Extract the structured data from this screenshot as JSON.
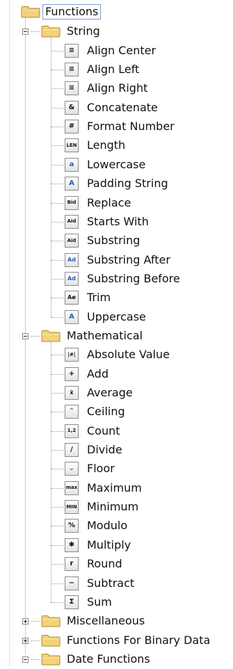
{
  "tree": {
    "root": {
      "label": "Functions"
    },
    "string": {
      "label": "String",
      "items": [
        {
          "label": "Align Center",
          "icon": "align-center-icon",
          "glyph": "≡"
        },
        {
          "label": "Align Left",
          "icon": "align-left-icon",
          "glyph": "≡"
        },
        {
          "label": "Align Right",
          "icon": "align-right-icon",
          "glyph": "≡"
        },
        {
          "label": "Concatenate",
          "icon": "ampersand-icon",
          "glyph": "&"
        },
        {
          "label": "Format Number",
          "icon": "format-number-icon",
          "glyph": "#"
        },
        {
          "label": "Length",
          "icon": "length-icon",
          "glyph": "LEN"
        },
        {
          "label": "Lowercase",
          "icon": "lowercase-icon",
          "glyph": "a"
        },
        {
          "label": "Padding String",
          "icon": "padding-string-icon",
          "glyph": "A"
        },
        {
          "label": "Replace",
          "icon": "replace-icon",
          "glyph": "Bid"
        },
        {
          "label": "Starts With",
          "icon": "starts-with-icon",
          "glyph": "Aid"
        },
        {
          "label": "Substring",
          "icon": "substring-icon",
          "glyph": "Aid"
        },
        {
          "label": "Substring After",
          "icon": "substring-after-icon",
          "glyph": "Ad"
        },
        {
          "label": "Substring Before",
          "icon": "substring-before-icon",
          "glyph": "Ad"
        },
        {
          "label": "Trim",
          "icon": "trim-icon",
          "glyph": "Aø"
        },
        {
          "label": "Uppercase",
          "icon": "uppercase-icon",
          "glyph": "A"
        }
      ]
    },
    "mathematical": {
      "label": "Mathematical",
      "items": [
        {
          "label": "Absolute Value",
          "icon": "absolute-value-icon",
          "glyph": "|#|"
        },
        {
          "label": "Add",
          "icon": "plus-icon",
          "glyph": "+"
        },
        {
          "label": "Average",
          "icon": "average-icon",
          "glyph": "x̄"
        },
        {
          "label": "Ceiling",
          "icon": "ceiling-icon",
          "glyph": "⌃"
        },
        {
          "label": "Count",
          "icon": "count-icon",
          "glyph": "1,2"
        },
        {
          "label": "Divide",
          "icon": "divide-icon",
          "glyph": "/"
        },
        {
          "label": "Floor",
          "icon": "floor-icon",
          "glyph": "⌄"
        },
        {
          "label": "Maximum",
          "icon": "maximum-icon",
          "glyph": "max"
        },
        {
          "label": "Minimum",
          "icon": "minimum-icon",
          "glyph": "MIN"
        },
        {
          "label": "Modulo",
          "icon": "modulo-icon",
          "glyph": "%"
        },
        {
          "label": "Multiply",
          "icon": "multiply-icon",
          "glyph": "✱"
        },
        {
          "label": "Round",
          "icon": "round-icon",
          "glyph": "r"
        },
        {
          "label": "Subtract",
          "icon": "minus-icon",
          "glyph": "−"
        },
        {
          "label": "Sum",
          "icon": "sum-icon",
          "glyph": "Σ"
        }
      ]
    },
    "collapsed": [
      {
        "label": "Miscellaneous"
      },
      {
        "label": "Functions For Binary Data"
      },
      {
        "label": "Date Functions"
      }
    ]
  },
  "colors": {
    "folder": "#f2d27a",
    "folder_edge": "#b08a2c",
    "selection_border": "#7a9cd3",
    "icon_accent": "#c0302e",
    "icon_blue": "#2f5fb3"
  }
}
